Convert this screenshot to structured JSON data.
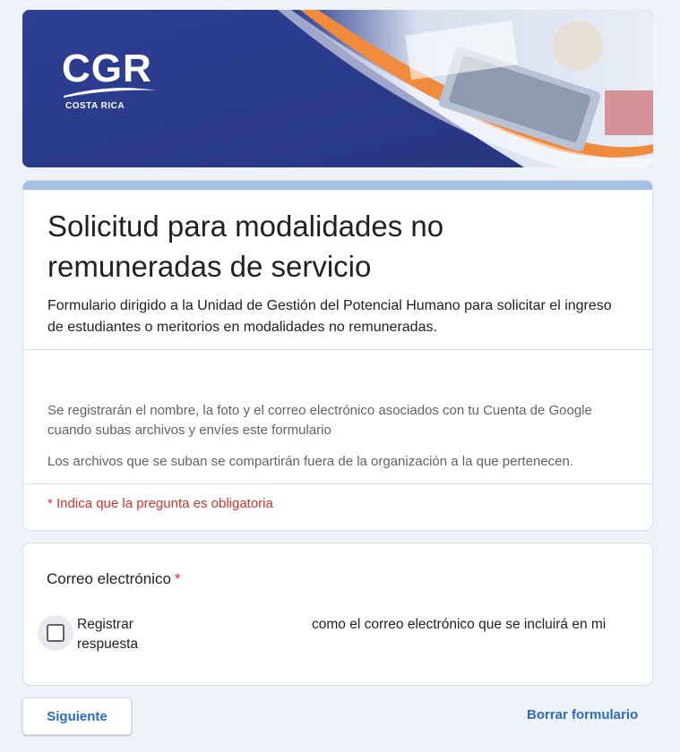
{
  "banner": {
    "logo_text": "CGR",
    "logo_subtext": "COSTA RICA"
  },
  "form": {
    "title": "Solicitud para modalidades no remuneradas de servicio",
    "description": "Formulario dirigido a la Unidad de Gestión del Potencial Humano para solicitar el ingreso de estudiantes o meritorios en modalidades no remuneradas.",
    "account_notice": "Se registrarán el nombre, la foto y el correo electrónico asociados con tu Cuenta de Google cuando subas archivos y envíes este formulario",
    "sharing_notice": "Los archivos que se suban se compartirán fuera de la organización a la que pertenecen.",
    "required_note": "* Indica que la pregunta es obligatoria"
  },
  "question": {
    "title": "Correo electrónico",
    "required_mark": "*",
    "checkbox_label_part1": "Registrar respuesta",
    "checkbox_label_part2": "como el correo electrónico que se incluirá en mi"
  },
  "actions": {
    "next_label": "Siguiente",
    "clear_label": "Borrar formulario"
  },
  "colors": {
    "accent": "#2a6ac2",
    "required": "#d93025",
    "header_bar": "#a4c1e4",
    "banner_blue": "#2b3a8c",
    "banner_orange": "#f08a3c"
  }
}
